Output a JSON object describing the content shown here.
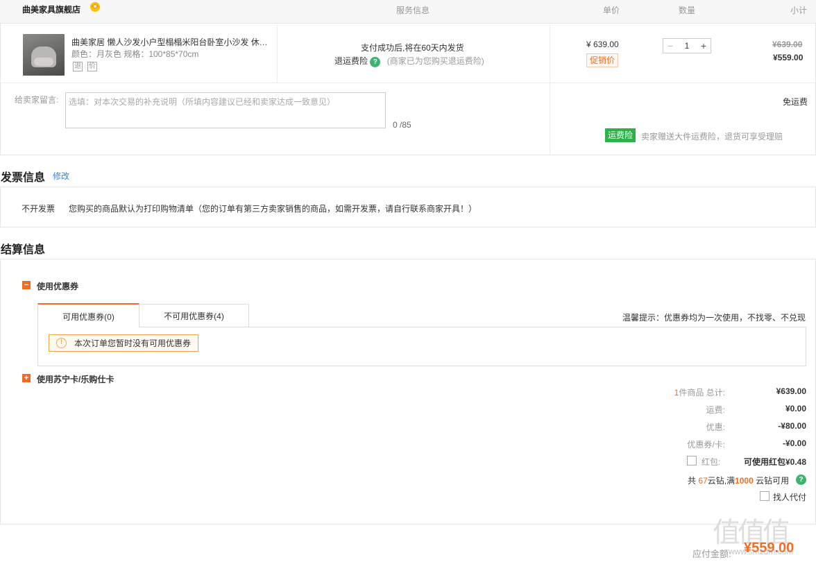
{
  "order_header": {
    "store_name": "曲美家具旗舰店",
    "col_service": "服务信息",
    "col_price": "单价",
    "col_qty": "数量",
    "col_subtotal": "小计"
  },
  "item": {
    "title": "曲美家居 懒人沙发小户型榻榻米阳台卧室小沙发 休闲…",
    "spec": "颜色：月灰色   规格：100*85*70cm",
    "tag_return": "退",
    "tag_price": "价",
    "service_line1": "支付成功后,将在60天内发货",
    "service_ins": "退运费险",
    "service_note": "(商家已为您购买退运费险)",
    "unit_price": "¥ 639.00",
    "promo_label": "促销价",
    "quantity": "1",
    "minus": "−",
    "plus": "+",
    "subtotal_old": "¥639.00",
    "subtotal_new": "¥559.00"
  },
  "message": {
    "label": "给卖家留言:",
    "placeholder": "选填：对本次交易的补充说明（所填内容建议已经和卖家达成一致意见）",
    "count": "0 /85"
  },
  "shipping": {
    "free_label": "免运费",
    "ins_badge": "运费险",
    "ins_text": "卖家赠送大件运费险，退货可享受理赔"
  },
  "invoice": {
    "title": "发票信息",
    "edit": "修改",
    "key": "不开发票",
    "value": "您购买的商品默认为打印购物清单（您的订单有第三方卖家销售的商品，如需开发票，请自行联系商家开具！）"
  },
  "settlement": {
    "title": "结算信息",
    "coupon_section": "使用优惠券",
    "tab_available": "可用优惠券(0)",
    "tab_unavailable": "不可用优惠券(4)",
    "tip": "温馨提示：优惠券均为一次使用，不找零、不兑现",
    "no_coupon": "本次订单您暂时没有可用优惠券",
    "card_section": "使用苏宁卡/乐购仕卡",
    "collapse_sign": "−",
    "expand_sign": "+",
    "summary": {
      "count_num": "1",
      "count_label": "件商品 总计:",
      "total": "¥639.00",
      "freight_label": "运费:",
      "freight": "¥0.00",
      "discount_label": "优惠:",
      "discount": "-¥80.00",
      "coupon_label": "优惠券/卡:",
      "coupon": "-¥0.00",
      "redpacket_label": "红包:",
      "redpacket": "可使用红包¥0.48",
      "diamond_pre": "共",
      "diamond_num": "67",
      "diamond_mid": "云钻,满",
      "diamond_need": "1000",
      "diamond_post": "云钻可用",
      "proxy_pay": "找人代付"
    }
  },
  "footer": {
    "pay_label": "应付金额:",
    "pay_amount": "¥559.00",
    "watermark": "值值值",
    "watermark_site": "www.smzdm.com"
  },
  "colors": {
    "accent": "#f26b1e",
    "green": "#2db14b",
    "link": "#3c7fd1"
  }
}
